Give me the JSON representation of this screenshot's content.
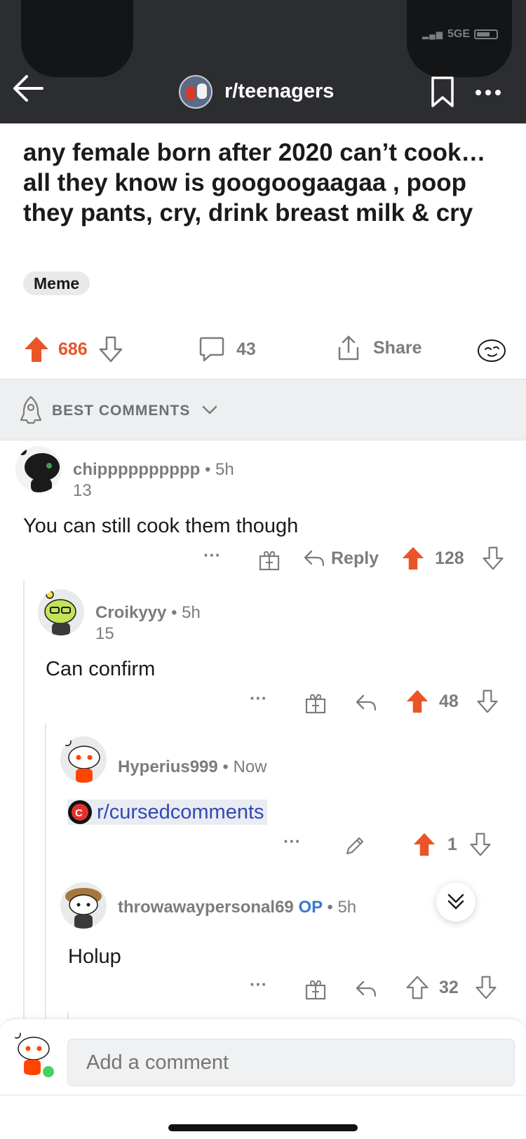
{
  "status_bar": {
    "network": "5GE"
  },
  "header": {
    "subreddit": "r/teenagers"
  },
  "post": {
    "title": "any female born after 2020 can’t cook… all they know is googoogaagaa , poop they pants, cry, drink breast milk & cry",
    "flair": "Meme",
    "votes": "686",
    "comments_count": "43",
    "share_label": "Share"
  },
  "sort": {
    "label": "BEST COMMENTS"
  },
  "comments": [
    {
      "user": "chipppppppppp",
      "time": "5h",
      "karma": "13",
      "body": "You can still cook them though",
      "reply_label": "Reply",
      "votes": "128",
      "more": "···"
    },
    {
      "user": "Croikyyy",
      "time": "5h",
      "karma": "15",
      "body": "Can confirm",
      "votes": "48",
      "more": "···"
    },
    {
      "user": "Hyperius999",
      "time": "Now",
      "body": "r/cursedcomments",
      "votes": "1",
      "more": "···"
    },
    {
      "user": "throwawaypersonal69",
      "op_badge": "OP",
      "time": "5h",
      "body": "Holup",
      "votes": "32",
      "more": "···"
    }
  ],
  "composer": {
    "placeholder": "Add a comment"
  },
  "colors": {
    "upvote": "#ea5428",
    "header_bg": "#2b2d31",
    "link": "#3149b8",
    "op": "#3a79d1"
  },
  "separator": "•"
}
